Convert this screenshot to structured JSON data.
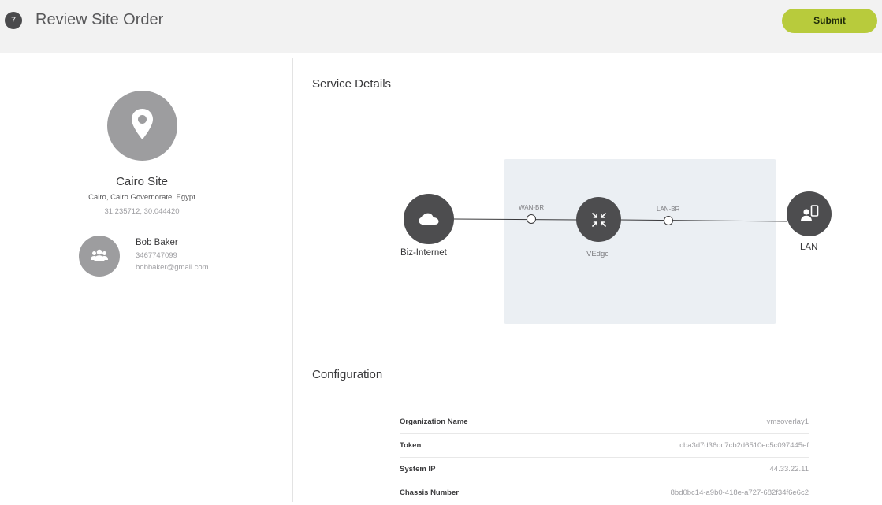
{
  "header": {
    "step_number": "7",
    "title": "Review Site Order",
    "submit_label": "Submit"
  },
  "site": {
    "name": "Cairo Site",
    "address": "Cairo, Cairo Governorate, Egypt",
    "coordinates": "31.235712, 30.044420",
    "icon": "map-pin-icon"
  },
  "contact": {
    "name": "Bob Baker",
    "phone": "3467747099",
    "email": "bobbaker@gmail.com",
    "icon": "users-icon"
  },
  "service_details": {
    "title": "Service Details",
    "nodes": {
      "internet": "Biz-Internet",
      "vedge": "VEdge",
      "lan": "LAN"
    },
    "ports": {
      "wan": "WAN-BR",
      "lan": "LAN-BR"
    }
  },
  "configuration": {
    "title": "Configuration",
    "rows": [
      {
        "key": "Organization Name",
        "value": "vmsoverlay1"
      },
      {
        "key": "Token",
        "value": "cba3d7d36dc7cb2d6510ec5c097445ef"
      },
      {
        "key": "System IP",
        "value": "44.33.22.11"
      },
      {
        "key": "Chassis Number",
        "value": "8bd0bc14-a9b0-418e-a727-682f34f6e6c2"
      }
    ]
  },
  "colors": {
    "accent": "#b8cb3c",
    "node": "#4d4d4f",
    "avatar": "#9d9d9f",
    "service_box": "#ebeff3"
  }
}
